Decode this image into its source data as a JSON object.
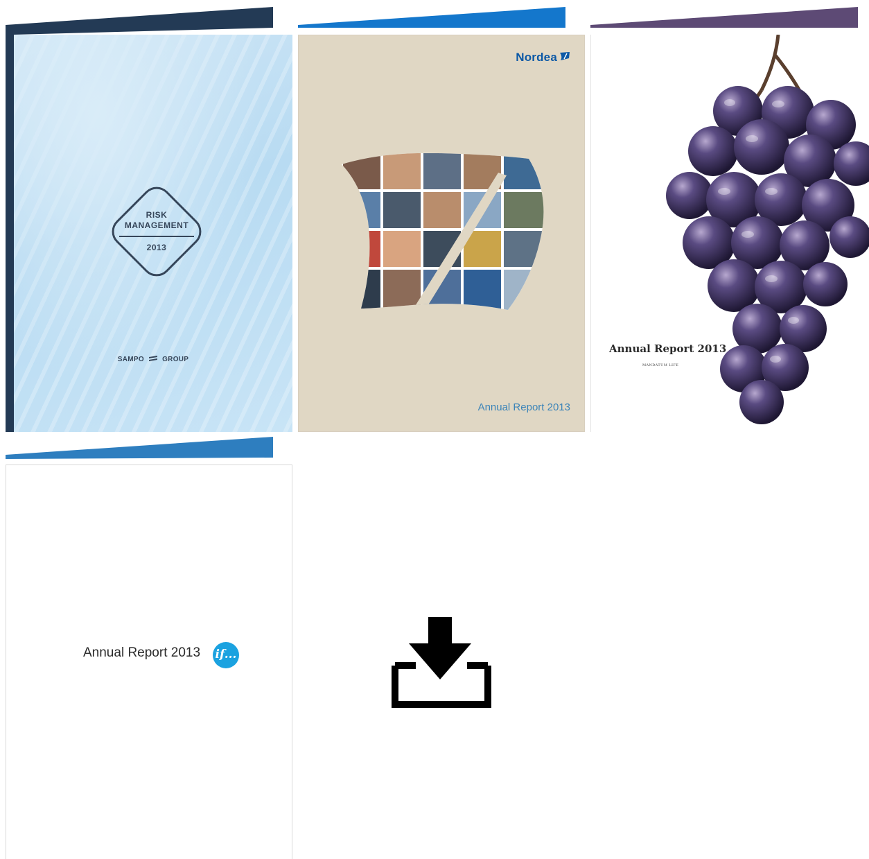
{
  "colors": {
    "flap_risk": "#233a55",
    "flap_nordea": "#1477cc",
    "flap_grapes": "#5d4a75",
    "flap_if": "#2e7ebf",
    "nordea_blue": "#0b58a6",
    "if_blue": "#1ba2e0"
  },
  "reports": [
    {
      "id": "risk-management",
      "title_line1": "RISK",
      "title_line2": "MANAGEMENT",
      "year": "2013",
      "publisher_left": "SAMPO",
      "publisher_right": "GROUP"
    },
    {
      "id": "nordea",
      "brand": "Nordea",
      "title": "Annual Report 2013"
    },
    {
      "id": "mandatum",
      "title": "Annual Report 2013",
      "brand": "MANDATUM LIFE"
    },
    {
      "id": "if",
      "title": "Annual Report 2013",
      "brand": "if..."
    }
  ],
  "icons": {
    "download": "download-icon"
  }
}
